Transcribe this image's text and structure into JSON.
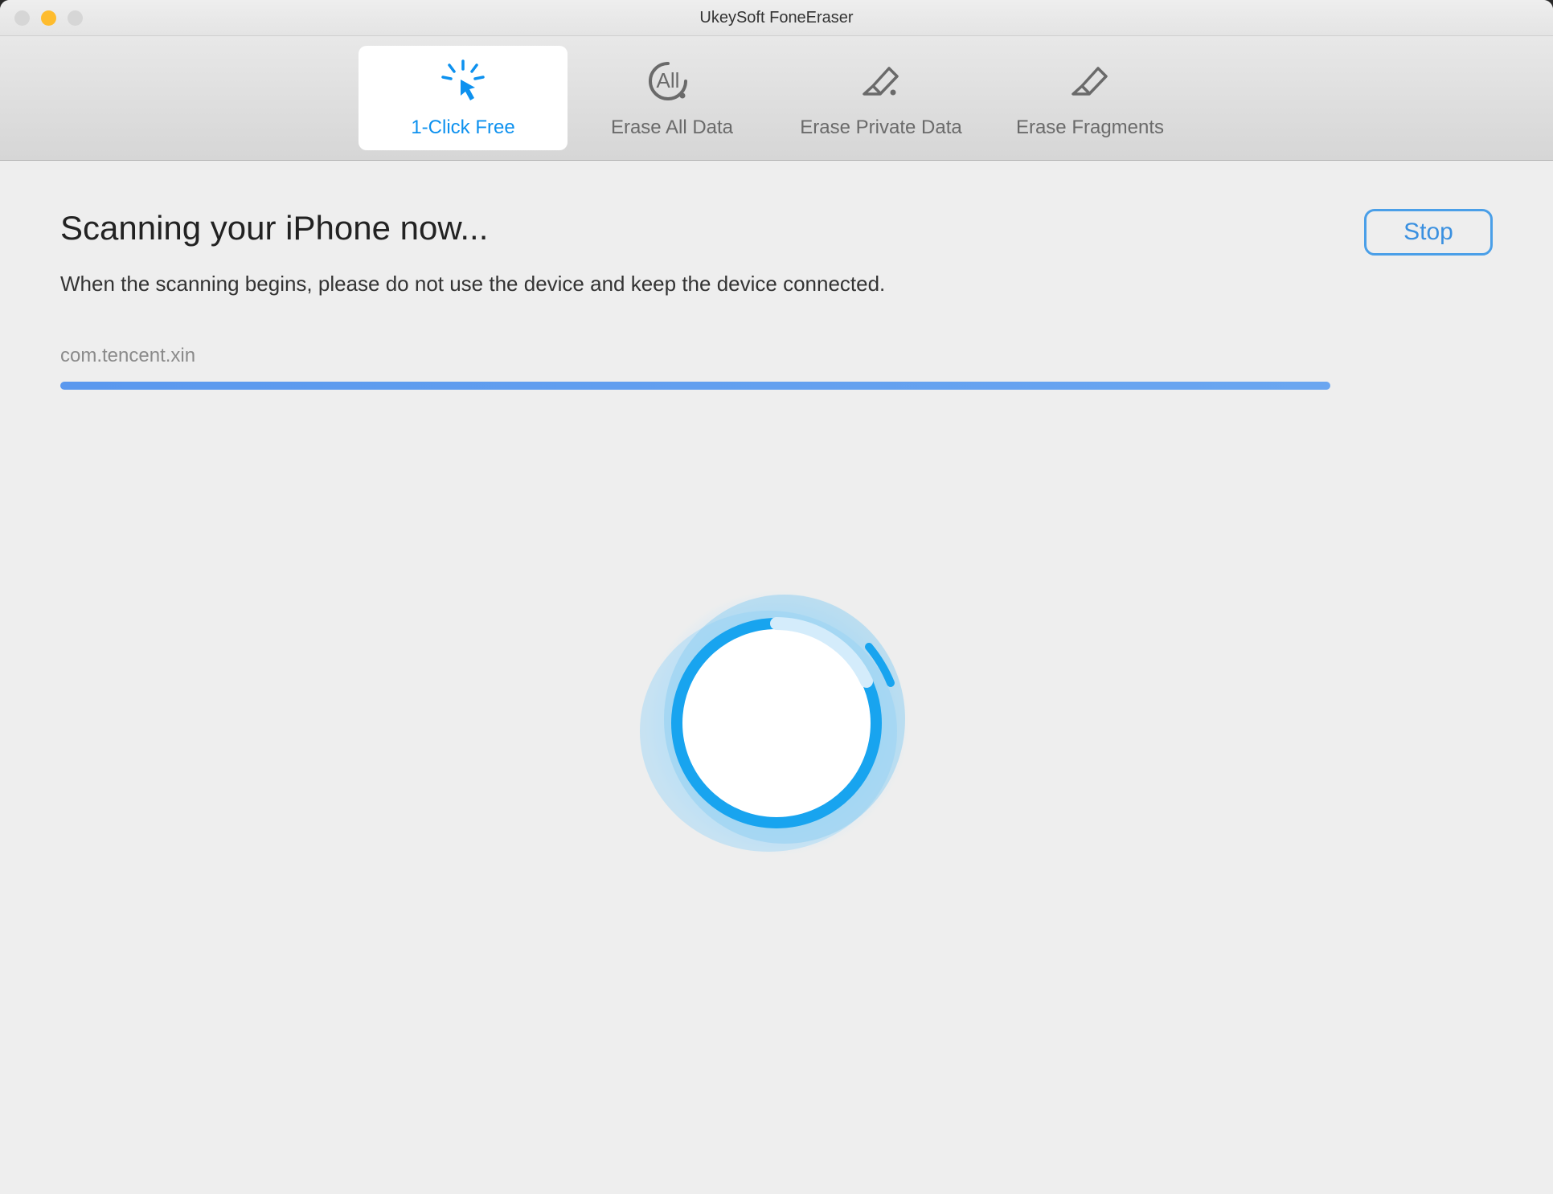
{
  "window": {
    "title": "UkeySoft FoneEraser"
  },
  "tabs": [
    {
      "label": "1-Click Free",
      "icon": "click-free-icon",
      "active": true
    },
    {
      "label": "Erase All Data",
      "icon": "erase-all-icon",
      "active": false
    },
    {
      "label": "Erase Private Data",
      "icon": "erase-private-icon",
      "active": false
    },
    {
      "label": "Erase Fragments",
      "icon": "erase-fragments-icon",
      "active": false
    }
  ],
  "main": {
    "heading": "Scanning your iPhone now...",
    "subheading": "When the scanning begins, please do not use the device and keep the device connected.",
    "stop_label": "Stop",
    "current_item": "com.tencent.xin",
    "progress_percent": 100
  },
  "colors": {
    "accent": "#0d91ef",
    "progress": "#5a98ee",
    "button_border": "#4a9fe8"
  }
}
